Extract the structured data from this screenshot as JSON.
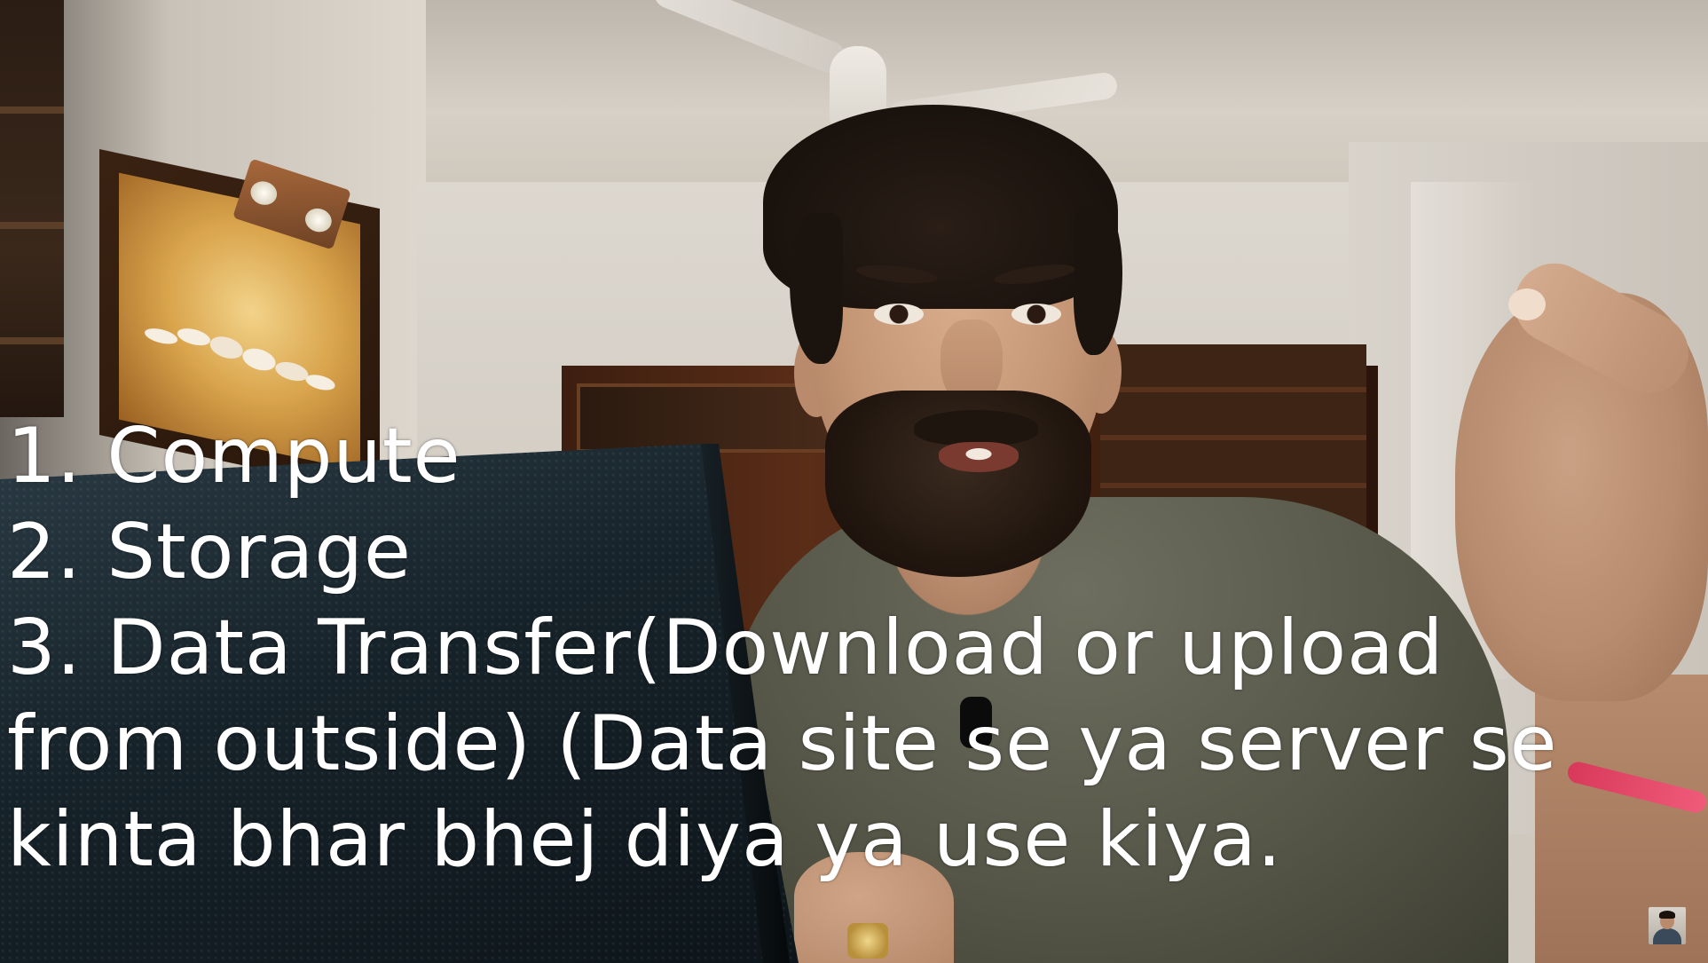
{
  "caption": {
    "lines": [
      "1. Compute",
      "2. Storage",
      "3. Data Transfer(Download or upload",
      "from outside) (Data site se ya server se",
      "kinta bhar bhej diya ya use kiya."
    ]
  },
  "colors": {
    "caption_text": "#ffffff",
    "shirt": "#565748",
    "wristband": "#e24767"
  },
  "icons": {
    "channel_avatar": "channel-avatar-icon"
  }
}
